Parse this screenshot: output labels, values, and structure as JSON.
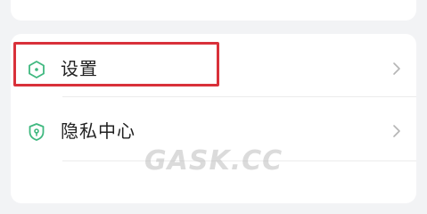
{
  "colors": {
    "background": "#f2f3f5",
    "card": "#ffffff",
    "icon_green": "#3fb87f",
    "highlight_red": "#d9313a",
    "text": "#222222",
    "chevron": "#b5b5b5"
  },
  "menu": {
    "items": [
      {
        "label": "设置",
        "icon": "settings-hexagon-icon",
        "highlighted": true
      },
      {
        "label": "隐私中心",
        "icon": "privacy-shield-icon",
        "highlighted": false
      }
    ]
  },
  "watermark": "GASK.CC"
}
